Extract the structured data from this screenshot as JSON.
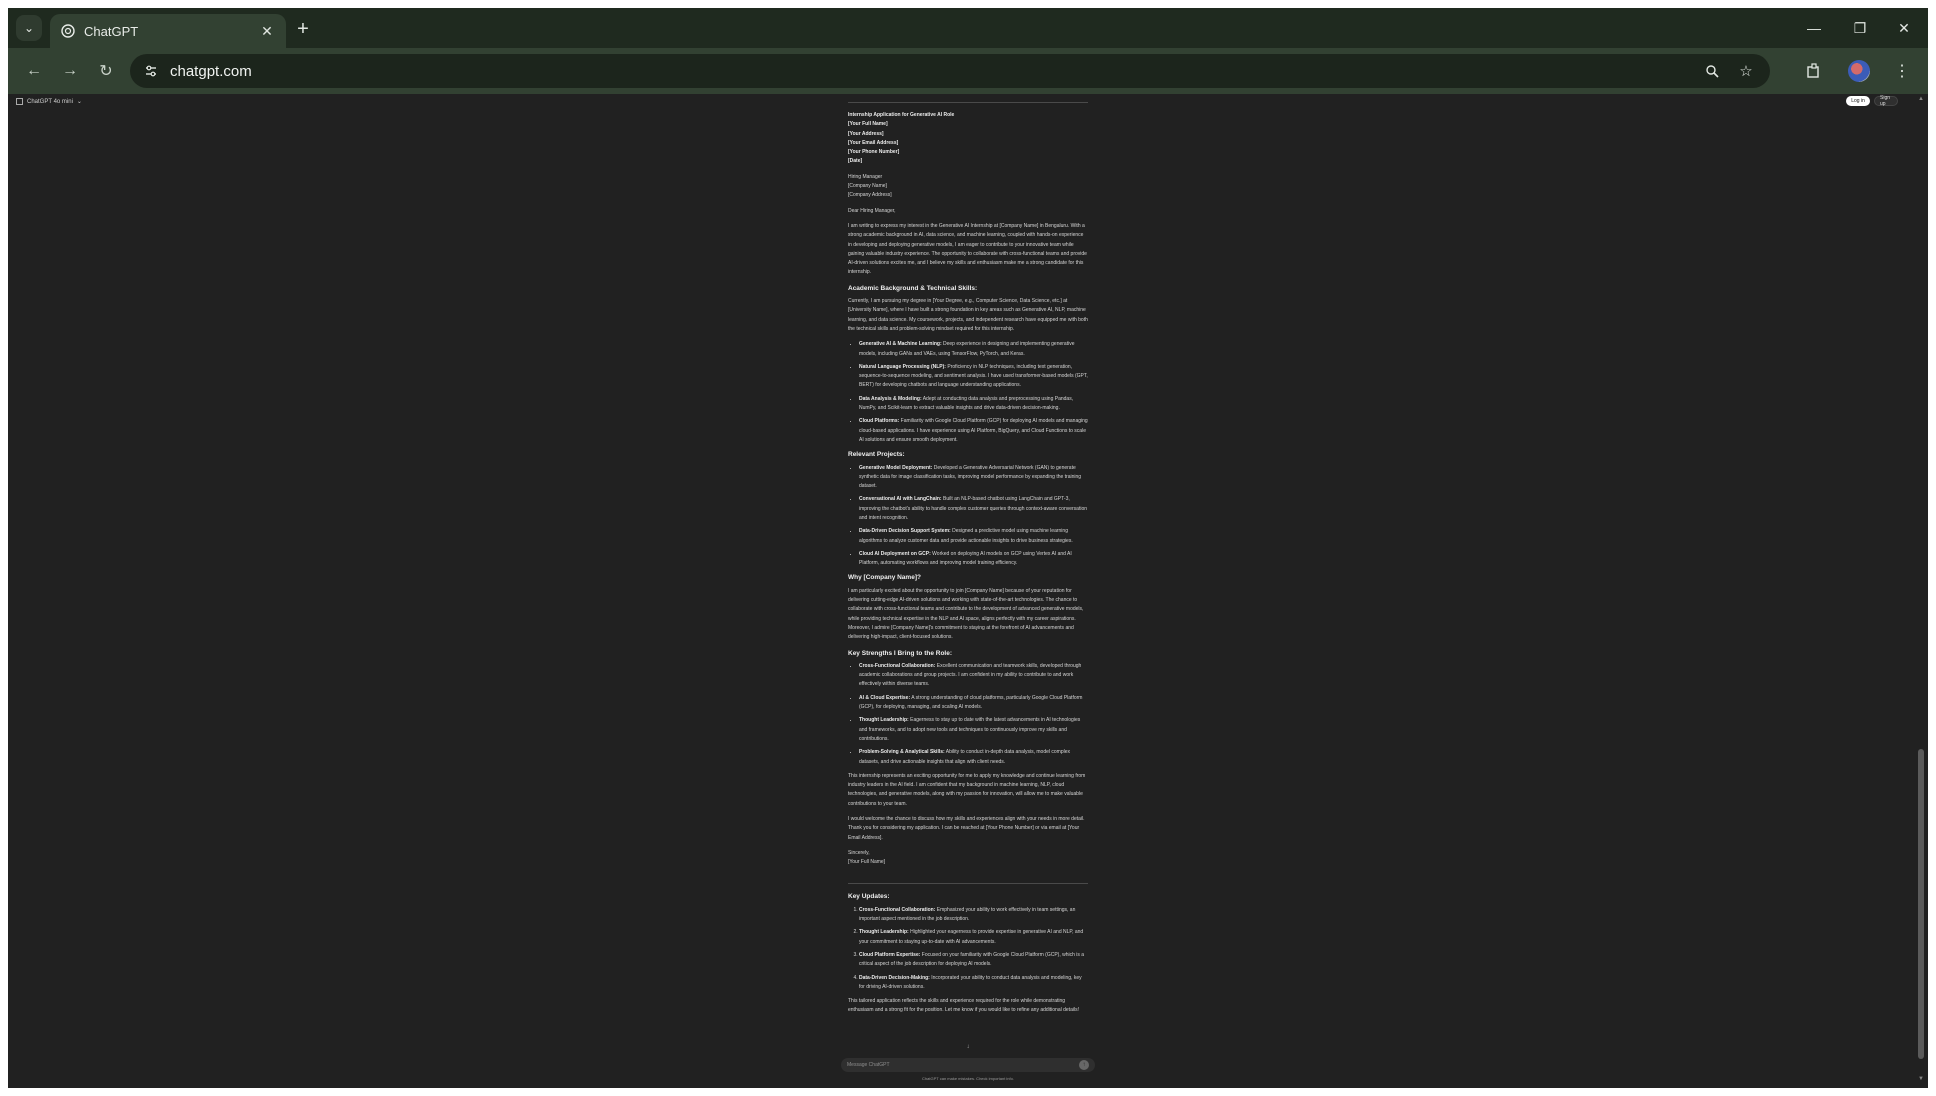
{
  "browser": {
    "tab_title": "ChatGPT",
    "url": "chatgpt.com",
    "icons": [
      "chevron-down-icon",
      "openai-favicon-icon",
      "close-icon",
      "plus-icon",
      "minimize-icon",
      "restore-icon",
      "close-window-icon",
      "back-icon",
      "forward-icon",
      "reload-icon",
      "site-info-icon",
      "zoom-icon",
      "star-icon",
      "extensions-icon",
      "profile-avatar",
      "more-icon"
    ]
  },
  "app": {
    "model_selector": "ChatGPT 4o mini",
    "login_label": "Log in",
    "signup_label": "Sign up",
    "composer_placeholder": "Message ChatGPT",
    "disclaimer": "ChatGPT can make mistakes. Check important info."
  },
  "letter": {
    "header": [
      "Internship Application for Generative AI Role",
      "[Your Full Name]",
      "[Your Address]",
      "[Your Email Address]",
      "[Your Phone Number]",
      "[Date]"
    ],
    "recipient": [
      "Hiring Manager",
      "[Company Name]",
      "[Company Address]"
    ],
    "salutation": "Dear Hiring Manager,",
    "intro": "I am writing to express my interest in the Generative AI Internship at [Company Name] in Bengaluru. With a strong academic background in AI, data science, and machine learning, coupled with hands-on experience in developing and deploying generative models, I am eager to contribute to your innovative team while gaining valuable industry experience. The opportunity to collaborate with cross-functional teams and provide AI-driven solutions excites me, and I believe my skills and enthusiasm make me a strong candidate for this internship.",
    "sections": [
      {
        "title": "Academic Background & Technical Skills:",
        "intro": "Currently, I am pursuing my degree in [Your Degree, e.g., Computer Science, Data Science, etc.] at [University Name], where I have built a strong foundation in key areas such as Generative AI, NLP, machine learning, and data science. My coursework, projects, and independent research have equipped me with both the technical skills and problem-solving mindset required for this internship.",
        "items": [
          {
            "label": "Generative AI & Machine Learning:",
            "text": "Deep experience in designing and implementing generative models, including GANs and VAEs, using TensorFlow, PyTorch, and Keras."
          },
          {
            "label": "Natural Language Processing (NLP):",
            "text": "Proficiency in NLP techniques, including text generation, sequence-to-sequence modeling, and sentiment analysis. I have used transformer-based models (GPT, BERT) for developing chatbots and language understanding applications."
          },
          {
            "label": "Data Analysis & Modeling:",
            "text": "Adept at conducting data analysis and preprocessing using Pandas, NumPy, and Scikit-learn to extract valuable insights and drive data-driven decision-making."
          },
          {
            "label": "Cloud Platforms:",
            "text": "Familiarity with Google Cloud Platform (GCP) for deploying AI models and managing cloud-based applications. I have experience using AI Platform, BigQuery, and Cloud Functions to scale AI solutions and ensure smooth deployment."
          }
        ]
      },
      {
        "title": "Relevant Projects:",
        "items": [
          {
            "label": "Generative Model Deployment:",
            "text": "Developed a Generative Adversarial Network (GAN) to generate synthetic data for image classification tasks, improving model performance by expanding the training dataset."
          },
          {
            "label": "Conversational AI with LangChain:",
            "text": "Built an NLP-based chatbot using LangChain and GPT-3, improving the chatbot's ability to handle complex customer queries through context-aware conversation and intent recognition."
          },
          {
            "label": "Data-Driven Decision Support System:",
            "text": "Designed a predictive model using machine learning algorithms to analyze customer data and provide actionable insights to drive business strategies."
          },
          {
            "label": "Cloud AI Deployment on GCP:",
            "text": "Worked on deploying AI models on GCP using Vertex AI and AI Platform, automating workflows and improving model training efficiency."
          }
        ]
      },
      {
        "title": "Why [Company Name]?",
        "intro": "I am particularly excited about the opportunity to join [Company Name] because of your reputation for delivering cutting-edge AI-driven solutions and working with state-of-the-art technologies. The chance to collaborate with cross-functional teams and contribute to the development of advanced generative models, while providing technical expertise in the NLP and AI space, aligns perfectly with my career aspirations. Moreover, I admire [Company Name]'s commitment to staying at the forefront of AI advancements and delivering high-impact, client-focused solutions.",
        "items": []
      },
      {
        "title": "Key Strengths I Bring to the Role:",
        "items": [
          {
            "label": "Cross-Functional Collaboration:",
            "text": "Excellent communication and teamwork skills, developed through academic collaborations and group projects. I am confident in my ability to contribute to and work effectively within diverse teams."
          },
          {
            "label": "AI & Cloud Expertise:",
            "text": "A strong understanding of cloud platforms, particularly Google Cloud Platform (GCP), for deploying, managing, and scaling AI models."
          },
          {
            "label": "Thought Leadership:",
            "text": "Eagerness to stay up to date with the latest advancements in AI technologies and frameworks, and to adopt new tools and techniques to continuously improve my skills and contributions."
          },
          {
            "label": "Problem-Solving & Analytical Skills:",
            "text": "Ability to conduct in-depth data analysis, model complex datasets, and drive actionable insights that align with client needs."
          }
        ]
      }
    ],
    "closing_paragraphs": [
      "This internship represents an exciting opportunity for me to apply my knowledge and continue learning from industry leaders in the AI field. I am confident that my background in machine learning, NLP, cloud technologies, and generative models, along with my passion for innovation, will allow me to make valuable contributions to your team.",
      "I would welcome the chance to discuss how my skills and experiences align with your needs in more detail. Thank you for considering my application. I can be reached at [Your Phone Number] or via email at [Your Email Address]."
    ],
    "signoff": [
      "Sincerely,",
      "[Your Full Name]"
    ]
  },
  "updates": {
    "title": "Key Updates:",
    "items": [
      {
        "label": "Cross-Functional Collaboration:",
        "text": "Emphasized your ability to work effectively in team settings, an important aspect mentioned in the job description."
      },
      {
        "label": "Thought Leadership:",
        "text": "Highlighted your eagerness to provide expertise in generative AI and NLP, and your commitment to staying up-to-date with AI advancements."
      },
      {
        "label": "Cloud Platform Expertise:",
        "text": "Focused on your familiarity with Google Cloud Platform (GCP), which is a critical aspect of the job description for deploying AI models."
      },
      {
        "label": "Data-Driven Decision-Making:",
        "text": "Incorporated your ability to conduct data analysis and modeling, key for driving AI-driven solutions."
      }
    ],
    "footer": "This tailored application reflects the skills and experience required for the role while demonstrating enthusiasm and a strong fit for the position. Let me know if you would like to refine any additional details!"
  }
}
